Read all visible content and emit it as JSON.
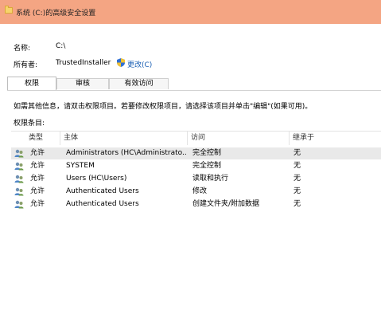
{
  "window": {
    "title": "系统 (C:)的高级安全设置"
  },
  "fields": {
    "name_label": "名称:",
    "name_value": "C:\\",
    "owner_label": "所有者:",
    "owner_value": "TrustedInstaller",
    "change_link": "更改(C)"
  },
  "tabs": [
    {
      "label": "权限",
      "active": true
    },
    {
      "label": "审核",
      "active": false
    },
    {
      "label": "有效访问",
      "active": false
    }
  ],
  "info_text": "如需其他信息，请双击权限项目。若要修改权限项目，请选择该项目并单击\"编辑\"(如果可用)。",
  "entries_label": "权限条目:",
  "columns": [
    "类型",
    "主体",
    "访问",
    "继承于"
  ],
  "rows": [
    {
      "type": "允许",
      "principal": "Administrators (HC\\Administrato...",
      "access": "完全控制",
      "inherited": "无",
      "selected": true
    },
    {
      "type": "允许",
      "principal": "SYSTEM",
      "access": "完全控制",
      "inherited": "无",
      "selected": false
    },
    {
      "type": "允许",
      "principal": "Users (HC\\Users)",
      "access": "读取和执行",
      "inherited": "无",
      "selected": false
    },
    {
      "type": "允许",
      "principal": "Authenticated Users",
      "access": "修改",
      "inherited": "无",
      "selected": false
    },
    {
      "type": "允许",
      "principal": "Authenticated Users",
      "access": "创建文件夹/附加数据",
      "inherited": "无",
      "selected": false
    }
  ],
  "icons": {
    "title": "folder-icon",
    "change": "uac-shield-icon",
    "row": "users-icon"
  },
  "colors": {
    "titlebar": "#f4a583",
    "link": "#1a5fb4",
    "selected_row": "#e9e9e9"
  }
}
